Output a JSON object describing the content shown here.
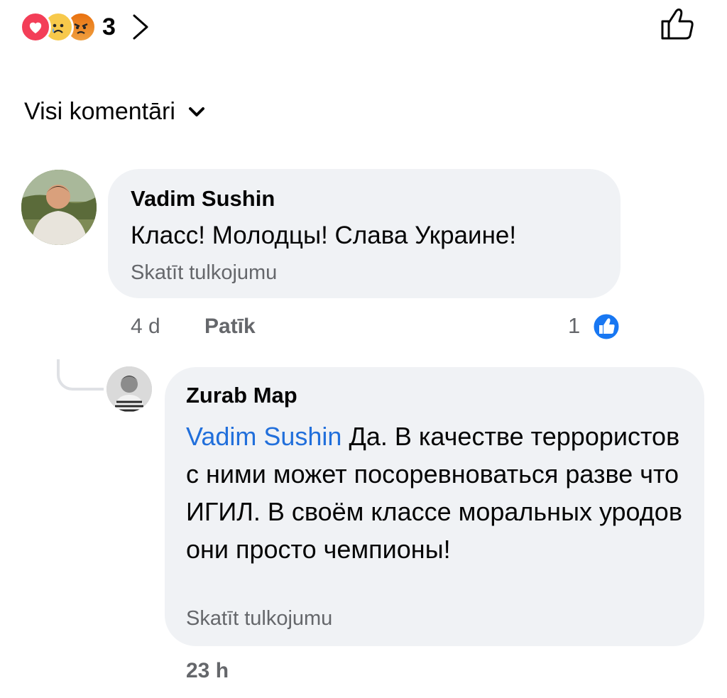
{
  "reactions": {
    "icons": [
      "love-reaction",
      "sad-reaction",
      "angry-reaction"
    ],
    "count": "3"
  },
  "filter": {
    "label": "Visi komentāri"
  },
  "comments": [
    {
      "author": "Vadim Sushin",
      "text": "Класс! Молодцы! Слава Украине!",
      "translate_label": "Skatīt tulkojumu",
      "time": "4 d",
      "like_label": "Patīk",
      "like_count": "1"
    }
  ],
  "reply": {
    "author": "Zurab Map",
    "mention": "Vadim Sushin",
    "text": "Да. В качестве террористов с ними может посоревноваться разве что ИГИЛ. В своём классе моральных уродов они просто чемпионы!",
    "translate_label": "Skatīt tulkojumu",
    "time": "23 h"
  },
  "colors": {
    "link": "#216fdb",
    "secondary_text": "#65676b",
    "bubble": "#f0f2f5",
    "like_blue": "#1877f2"
  }
}
